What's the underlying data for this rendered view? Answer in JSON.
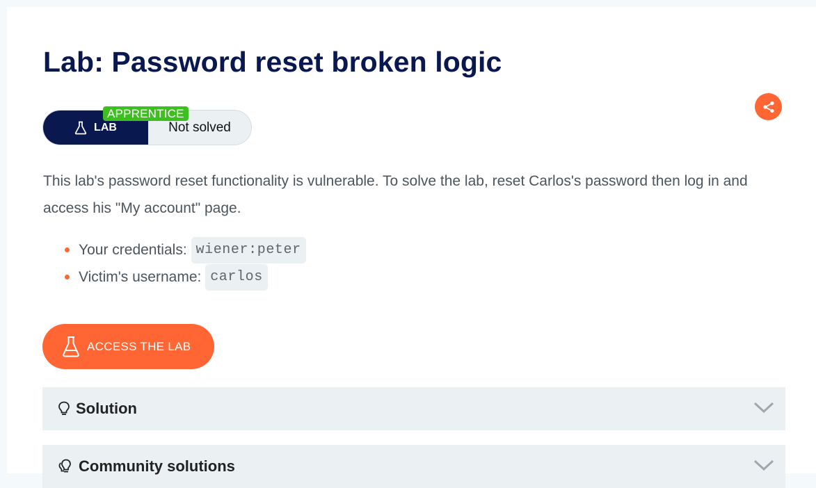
{
  "page": {
    "title": "Lab: Password reset broken logic"
  },
  "badge": {
    "lab_label": "LAB",
    "status": "Not solved",
    "level": "APPRENTICE"
  },
  "description": "This lab's password reset functionality is vulnerable. To solve the lab, reset Carlos's password then log in and access his \"My account\" page.",
  "credentials": [
    {
      "label": "Your credentials:",
      "value": "wiener:peter"
    },
    {
      "label": "Victim's username:",
      "value": "carlos"
    }
  ],
  "access_button": {
    "label": "ACCESS THE LAB"
  },
  "accordions": [
    {
      "title": "Solution",
      "icon": "lightbulb-icon"
    },
    {
      "title": "Community solutions",
      "icon": "lightbulbs-icon"
    }
  ],
  "colors": {
    "accent": "#ff6633",
    "navy": "#0a1850",
    "level_green": "#3cbf1f",
    "panel": "#ebf0f2"
  }
}
